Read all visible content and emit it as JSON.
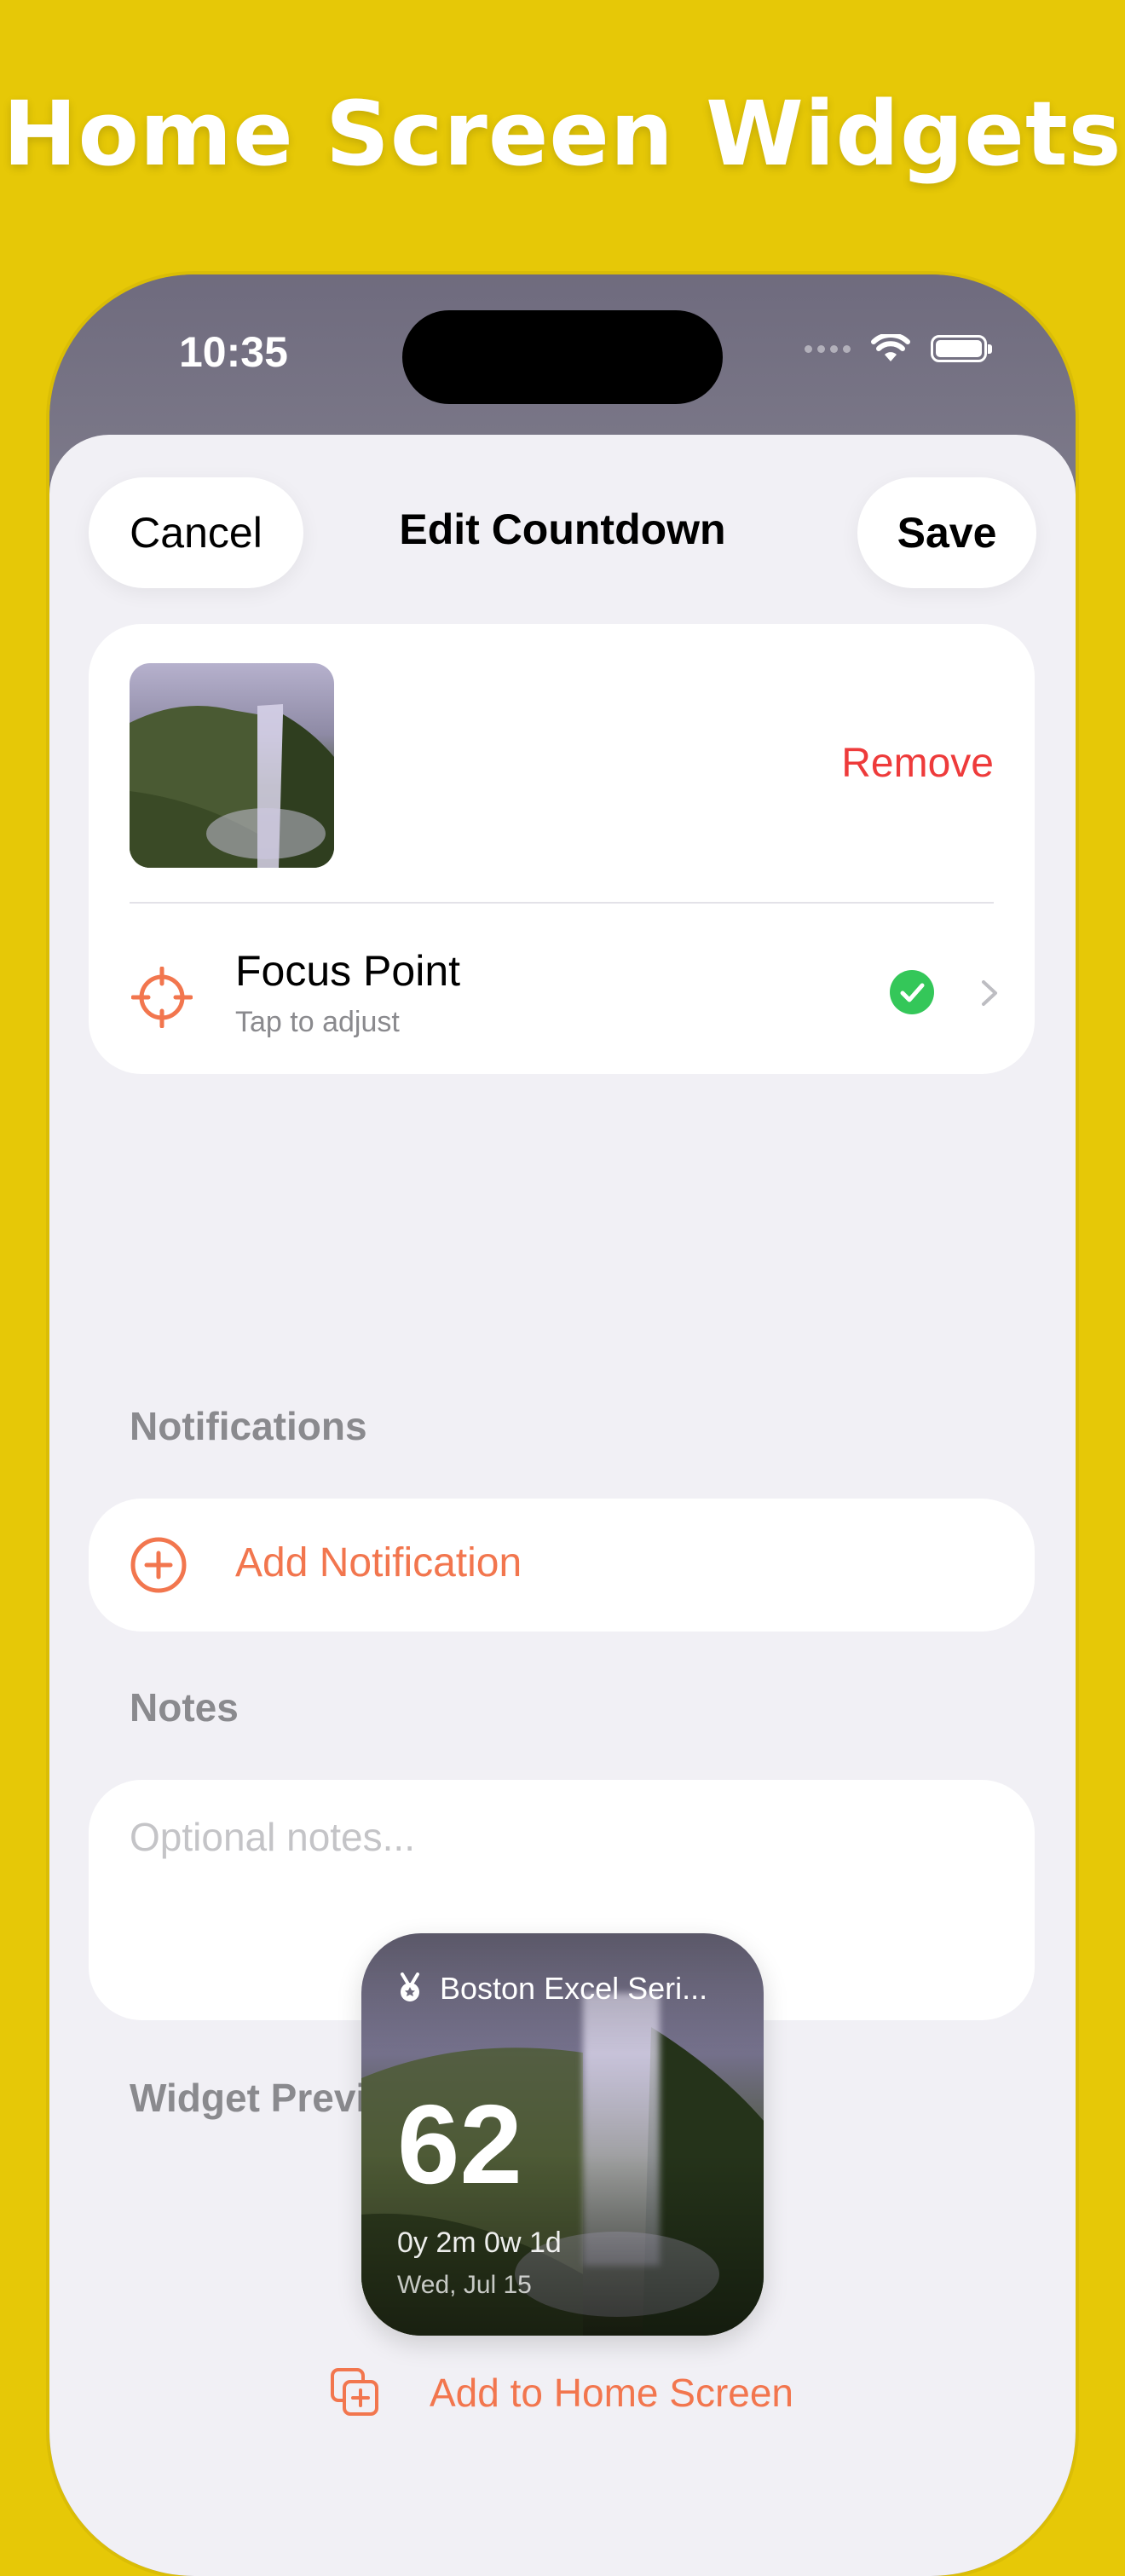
{
  "headline": "Home Screen Widgets",
  "status_bar": {
    "time": "10:35"
  },
  "nav": {
    "cancel": "Cancel",
    "title": "Edit Countdown",
    "save": "Save"
  },
  "photo": {
    "remove": "Remove"
  },
  "focus_point": {
    "title": "Focus Point",
    "subtitle": "Tap to adjust",
    "status_icon": "checkmark-circle-icon"
  },
  "notifications": {
    "section": "Notifications",
    "add": "Add Notification",
    "icon": "plus-circle-icon"
  },
  "notes": {
    "section": "Notes",
    "placeholder": "Optional notes..."
  },
  "widget_preview": {
    "section": "Widget Preview",
    "title": "Boston Excel Seri...",
    "number": "62",
    "duration": "0y 2m 0w 1d",
    "date": "Wed, Jul 15"
  },
  "add_home": {
    "label": "Add to Home Screen",
    "icon": "add-to-home-icon"
  },
  "colors": {
    "background": "#E6C807",
    "accent": "#F2764E",
    "destructive": "#EE3B3B",
    "success": "#34C759"
  }
}
